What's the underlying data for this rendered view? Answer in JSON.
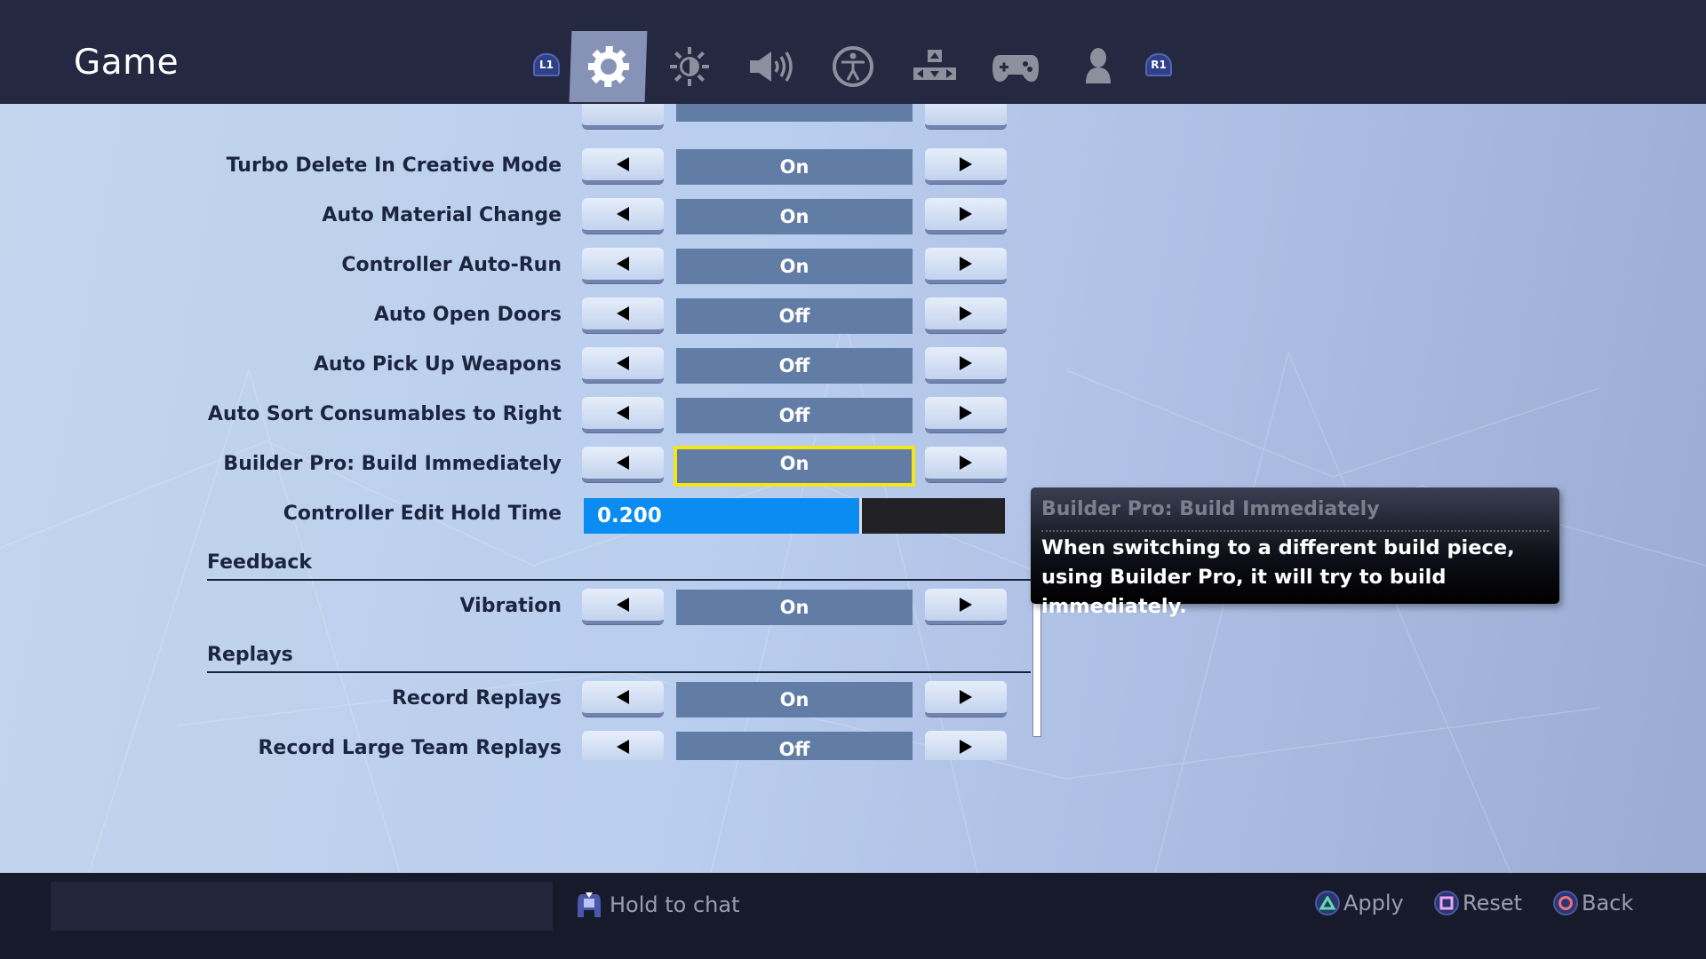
{
  "header": {
    "title": "Game",
    "left_bumper": "L1",
    "right_bumper": "R1",
    "tabs": [
      {
        "name": "game",
        "icon": "gear-icon",
        "active": true
      },
      {
        "name": "video",
        "icon": "brightness-icon",
        "active": false
      },
      {
        "name": "audio",
        "icon": "speaker-icon",
        "active": false
      },
      {
        "name": "accessibility",
        "icon": "accessibility-icon",
        "active": false
      },
      {
        "name": "input",
        "icon": "dpad-icon",
        "active": false
      },
      {
        "name": "controller",
        "icon": "gamepad-icon",
        "active": false
      },
      {
        "name": "account",
        "icon": "person-icon",
        "active": false
      }
    ]
  },
  "settings": {
    "rows": [
      {
        "label": "Turbo Delete In Creative Mode",
        "value": "On"
      },
      {
        "label": "Auto Material Change",
        "value": "On"
      },
      {
        "label": "Controller Auto-Run",
        "value": "On"
      },
      {
        "label": "Auto Open Doors",
        "value": "Off"
      },
      {
        "label": "Auto Pick Up Weapons",
        "value": "Off"
      },
      {
        "label": "Auto Sort Consumables to Right",
        "value": "Off"
      },
      {
        "label": "Builder Pro: Build Immediately",
        "value": "On"
      }
    ],
    "slider": {
      "label": "Controller Edit Hold Time",
      "value": "0.200",
      "fill_fraction": 0.66
    },
    "sections": [
      {
        "title": "Feedback",
        "rows": [
          {
            "label": "Vibration",
            "value": "On"
          }
        ]
      },
      {
        "title": "Replays",
        "rows": [
          {
            "label": "Record Replays",
            "value": "On"
          },
          {
            "label": "Record Large Team Replays",
            "value": "Off"
          }
        ]
      }
    ]
  },
  "tooltip": {
    "title": "Builder Pro: Build Immediately",
    "body": "When switching to a different build piece, using Builder Pro, it will try to build immediately."
  },
  "footer": {
    "chat_hint": "Hold to chat",
    "actions": [
      {
        "label": "Apply",
        "button": "triangle",
        "color": "#5fe0a8"
      },
      {
        "label": "Reset",
        "button": "square",
        "color": "#f0a6f0"
      },
      {
        "label": "Back",
        "button": "circle",
        "color": "#f0707f"
      }
    ]
  },
  "colors": {
    "header_bg": "#242840",
    "value_bg": "#617da6",
    "focus": "#f4e61a",
    "slider_fill": "#0a8cf3"
  }
}
